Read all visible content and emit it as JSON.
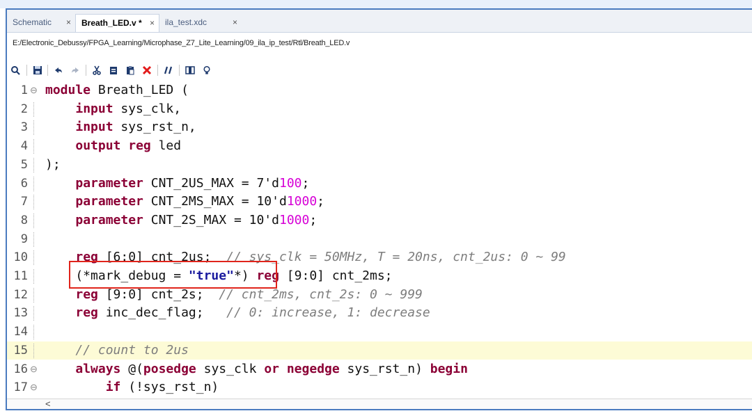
{
  "tabs": [
    {
      "label": "Schematic",
      "close": "×",
      "active": false
    },
    {
      "label": "Breath_LED.v *",
      "close": "×",
      "active": true
    },
    {
      "label": "ila_test.xdc",
      "close": "×",
      "active": false
    }
  ],
  "file_path": "E:/Electronic_Debussy/FPGA_Learning/Microphase_Z7_Lite_Learning/09_ila_ip_test/Rtl/Breath_LED.v",
  "toolbar_icons": [
    "search-icon",
    "save-icon",
    "undo-icon",
    "redo-icon",
    "cut-icon",
    "copy-icon",
    "paste-icon",
    "delete-icon",
    "comment-icon",
    "column-select-icon",
    "hint-icon"
  ],
  "colors": {
    "keyword": "#8b0035",
    "number": "#d600d6",
    "comment": "#7d7d7d",
    "string": "#1a1a9e",
    "highlight_box": "#e0241b",
    "current_line": "#fdfbd6"
  },
  "editor": {
    "scroll_arrow": "<",
    "lines": [
      {
        "n": "1",
        "fold": "⊖",
        "tokens": [
          {
            "t": "kw",
            "v": "module"
          },
          {
            "t": "p",
            "v": " Breath_LED ("
          }
        ]
      },
      {
        "n": "2",
        "tokens": [
          {
            "t": "p",
            "v": "    "
          },
          {
            "t": "kw",
            "v": "input"
          },
          {
            "t": "p",
            "v": " sys_clk,"
          }
        ]
      },
      {
        "n": "3",
        "tokens": [
          {
            "t": "p",
            "v": "    "
          },
          {
            "t": "kw",
            "v": "input"
          },
          {
            "t": "p",
            "v": " sys_rst_n,"
          }
        ]
      },
      {
        "n": "4",
        "tokens": [
          {
            "t": "p",
            "v": "    "
          },
          {
            "t": "kw",
            "v": "output"
          },
          {
            "t": "p",
            "v": " "
          },
          {
            "t": "kw",
            "v": "reg"
          },
          {
            "t": "p",
            "v": " led"
          }
        ]
      },
      {
        "n": "5",
        "tokens": [
          {
            "t": "p",
            "v": ");"
          }
        ]
      },
      {
        "n": "6",
        "tokens": [
          {
            "t": "p",
            "v": "    "
          },
          {
            "t": "kw",
            "v": "parameter"
          },
          {
            "t": "p",
            "v": " CNT_2US_MAX = 7'd"
          },
          {
            "t": "num",
            "v": "100"
          },
          {
            "t": "p",
            "v": ";"
          }
        ]
      },
      {
        "n": "7",
        "tokens": [
          {
            "t": "p",
            "v": "    "
          },
          {
            "t": "kw",
            "v": "parameter"
          },
          {
            "t": "p",
            "v": " CNT_2MS_MAX = 10'd"
          },
          {
            "t": "num",
            "v": "1000"
          },
          {
            "t": "p",
            "v": ";"
          }
        ]
      },
      {
        "n": "8",
        "tokens": [
          {
            "t": "p",
            "v": "    "
          },
          {
            "t": "kw",
            "v": "parameter"
          },
          {
            "t": "p",
            "v": " CNT_2S_MAX = 10'd"
          },
          {
            "t": "num",
            "v": "1000"
          },
          {
            "t": "p",
            "v": ";"
          }
        ]
      },
      {
        "n": "9",
        "tokens": []
      },
      {
        "n": "10",
        "tokens": [
          {
            "t": "p",
            "v": "    "
          },
          {
            "t": "kw",
            "v": "reg"
          },
          {
            "t": "p",
            "v": " [6:0] cnt_2us;  "
          },
          {
            "t": "cm",
            "v": "// sys_clk = 50MHz, T = 20ns, cnt_2us: 0 ~ 99"
          }
        ]
      },
      {
        "n": "11",
        "tokens": [
          {
            "t": "p",
            "v": "    (*mark_debug = "
          },
          {
            "t": "str",
            "v": "\"true\""
          },
          {
            "t": "p",
            "v": "*) "
          },
          {
            "t": "kw",
            "v": "reg"
          },
          {
            "t": "p",
            "v": " [9:0] cnt_2ms;"
          }
        ]
      },
      {
        "n": "12",
        "tokens": [
          {
            "t": "p",
            "v": "    "
          },
          {
            "t": "kw",
            "v": "reg"
          },
          {
            "t": "p",
            "v": " [9:0] cnt_2s;  "
          },
          {
            "t": "cm",
            "v": "// cnt_2ms, cnt_2s: 0 ~ 999"
          }
        ]
      },
      {
        "n": "13",
        "tokens": [
          {
            "t": "p",
            "v": "    "
          },
          {
            "t": "kw",
            "v": "reg"
          },
          {
            "t": "p",
            "v": " inc_dec_flag;   "
          },
          {
            "t": "cm",
            "v": "// 0: increase, 1: decrease"
          }
        ]
      },
      {
        "n": "14",
        "tokens": []
      },
      {
        "n": "15",
        "highlight": true,
        "tokens": [
          {
            "t": "p",
            "v": "    "
          },
          {
            "t": "cm",
            "v": "// count to 2us"
          }
        ]
      },
      {
        "n": "16",
        "fold": "⊖",
        "tokens": [
          {
            "t": "p",
            "v": "    "
          },
          {
            "t": "kw",
            "v": "always"
          },
          {
            "t": "p",
            "v": " @("
          },
          {
            "t": "kw",
            "v": "posedge"
          },
          {
            "t": "p",
            "v": " sys_clk "
          },
          {
            "t": "kw",
            "v": "or"
          },
          {
            "t": "p",
            "v": " "
          },
          {
            "t": "kw",
            "v": "negedge"
          },
          {
            "t": "p",
            "v": " sys_rst_n) "
          },
          {
            "t": "kw",
            "v": "begin"
          }
        ]
      },
      {
        "n": "17",
        "fold": "⊖",
        "tokens": [
          {
            "t": "p",
            "v": "        "
          },
          {
            "t": "kw",
            "v": "if"
          },
          {
            "t": "p",
            "v": " (!sys_rst_n)"
          }
        ]
      }
    ]
  }
}
